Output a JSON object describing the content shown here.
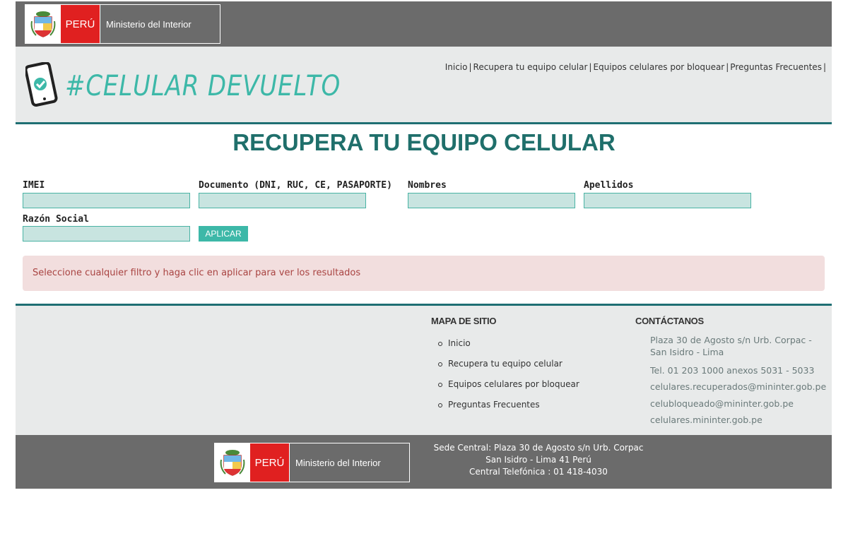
{
  "gov": {
    "peru_label": "PERÚ",
    "ministry_label": "Ministerio del Interior"
  },
  "brand": {
    "logo_text": "#CELULAR DEVUELTO"
  },
  "nav": {
    "items": [
      "Inicio",
      "Recupera tu equipo celular",
      "Equipos celulares por bloquear",
      "Preguntas Frecuentes"
    ]
  },
  "page": {
    "title": "RECUPERA TU EQUIPO CELULAR"
  },
  "filters": {
    "imei_label": "IMEI",
    "documento_label": "Documento (DNI, RUC, CE, PASAPORTE)",
    "nombres_label": "Nombres",
    "apellidos_label": "Apellidos",
    "razon_label": "Razón Social",
    "apply_label": "APLICAR"
  },
  "alert": {
    "message": "Seleccione cualquier filtro y haga clic en aplicar para ver los resultados"
  },
  "footer": {
    "sitemap_title": "MAPA DE SITIO",
    "sitemap_items": [
      "Inicio",
      "Recupera tu equipo celular",
      "Equipos celulares por bloquear",
      "Preguntas Frecuentes"
    ],
    "contact_title": "CONTÁCTANOS",
    "address": "Plaza 30 de Agosto s/n Urb. Corpac - San Isidro - Lima",
    "phone": "Tel. 01 203 1000 anexos 5031 - 5033",
    "email1": "celulares.recuperados@mininter.gob.pe",
    "email2": "celubloqueado@mininter.gob.pe",
    "website": "celulares.mininter.gob.pe"
  },
  "bottom": {
    "line1": "Sede Central: Plaza 30 de Agosto s/n Urb. Corpac",
    "line2": "San Isidro - Lima 41 Perú",
    "line3": "Central Telefónica : 01 418-4030"
  },
  "colors": {
    "teal": "#1f6f73",
    "accent": "#3db8a8",
    "gray_bar": "#6b6b6b",
    "red": "#e02020"
  }
}
